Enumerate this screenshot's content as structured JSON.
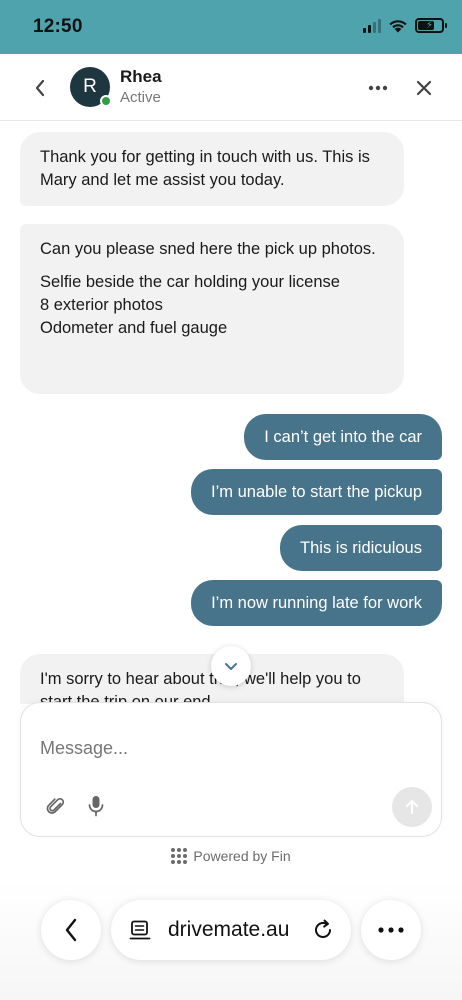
{
  "status_bar": {
    "time": "12:50",
    "battery_icon": "battery-charging-icon",
    "wifi_icon": "wifi-icon",
    "signal_icon": "cellular-signal-icon"
  },
  "header": {
    "avatar_initial": "R",
    "agent_name": "Rhea",
    "agent_status": "Active",
    "online_color": "#2ea043"
  },
  "messages": [
    {
      "from": "agent",
      "paragraphs": [
        "Thank you for getting in touch with us. This is Mary and let me assist you today."
      ]
    },
    {
      "from": "agent",
      "paragraphs": [
        "Can you please sned here the pick up photos.",
        "Selfie beside the car holding your license",
        "8 exterior photos",
        "Odometer and fuel gauge"
      ]
    },
    {
      "from": "user",
      "text": "I can’t get into the car"
    },
    {
      "from": "user",
      "text": "I’m unable to start the pickup"
    },
    {
      "from": "user",
      "text": "This is ridiculous"
    },
    {
      "from": "user",
      "text": "I’m now running late for work"
    },
    {
      "from": "agent",
      "paragraphs": [
        "I'm sorry to hear about this, we'll help you to start the trip on our end."
      ]
    }
  ],
  "composer": {
    "placeholder": "Message..."
  },
  "powered_by": "Powered by Fin",
  "browser": {
    "url": "drivemate.au"
  },
  "colors": {
    "status_bar": "#4ea3ad",
    "user_bubble": "#47748a",
    "agent_bubble": "#f2f2f2"
  }
}
